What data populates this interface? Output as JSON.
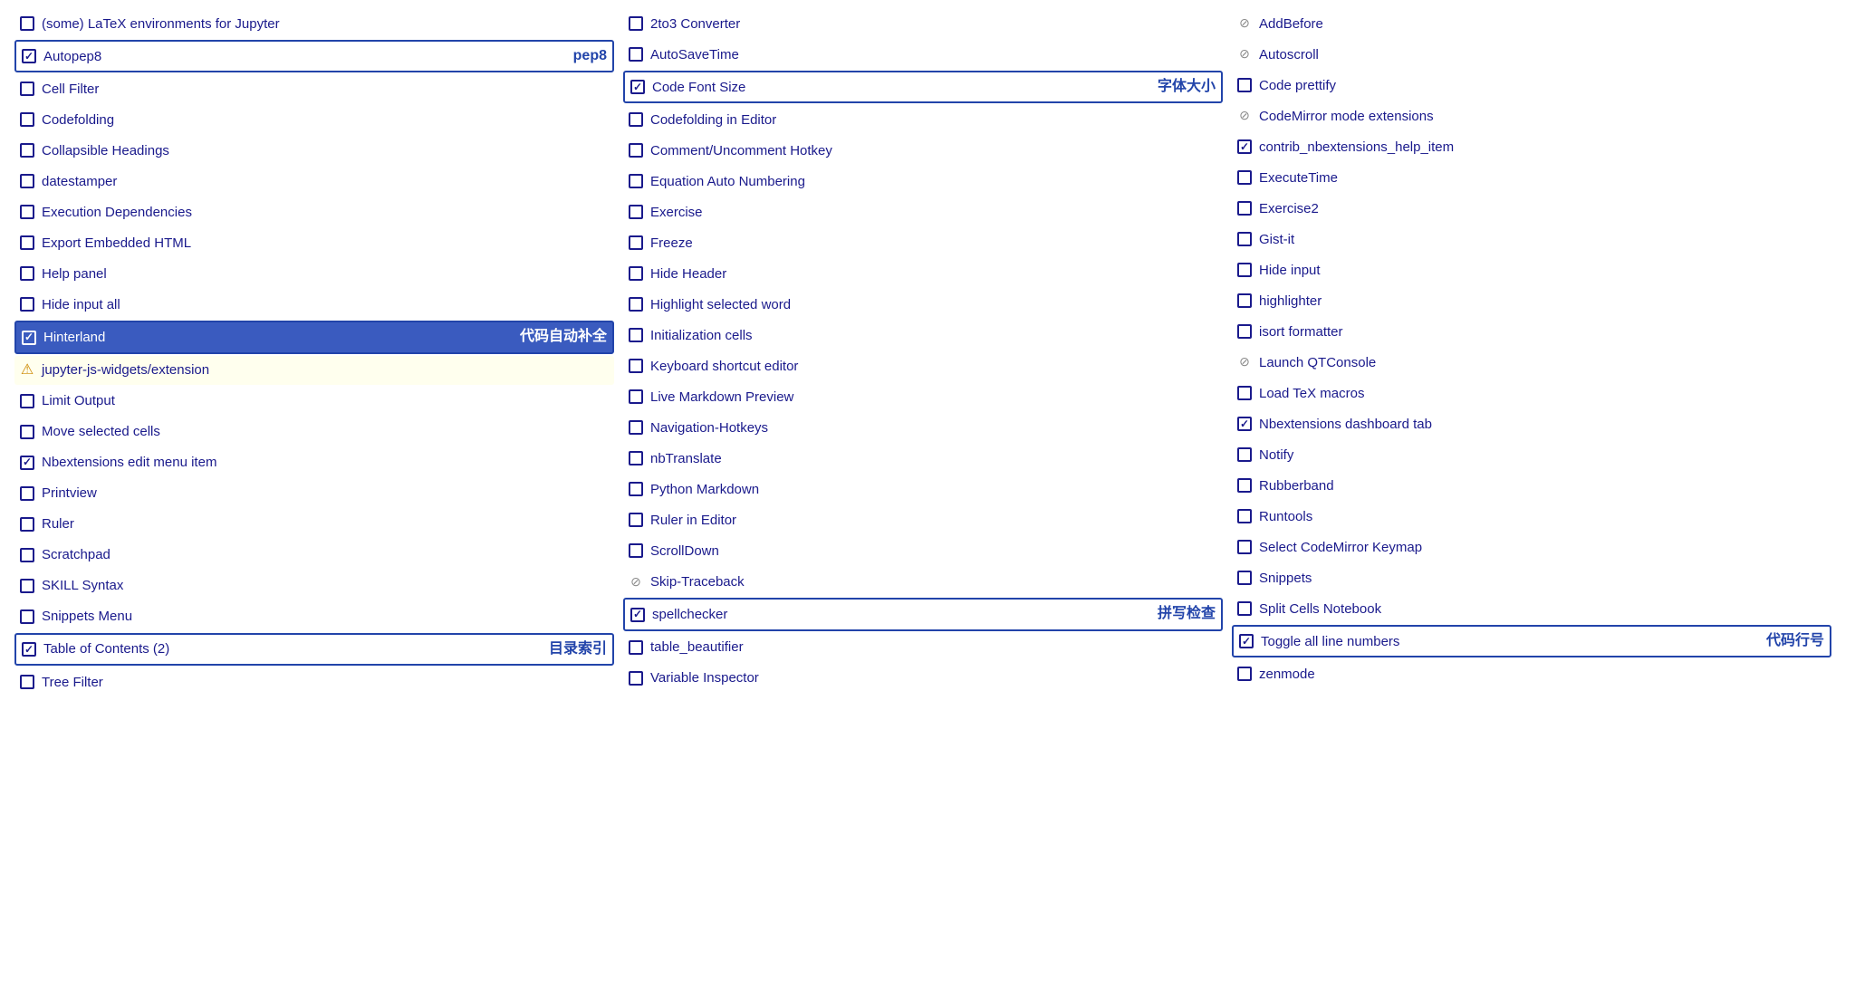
{
  "columns": [
    {
      "id": "col1",
      "items": [
        {
          "id": "latex",
          "check": "empty",
          "label": "(some) LaTeX environments for Jupyter",
          "badge": "",
          "style": "normal"
        },
        {
          "id": "autopep8",
          "check": "checked",
          "label": "Autopep8",
          "badge": "pep8",
          "style": "bordered"
        },
        {
          "id": "cell-filter",
          "check": "empty",
          "label": "Cell Filter",
          "badge": "",
          "style": "normal"
        },
        {
          "id": "codefolding",
          "check": "empty",
          "label": "Codefolding",
          "badge": "",
          "style": "normal"
        },
        {
          "id": "collapsible-headings",
          "check": "empty",
          "label": "Collapsible Headings",
          "badge": "",
          "style": "normal"
        },
        {
          "id": "datestamper",
          "check": "empty",
          "label": "datestamper",
          "badge": "",
          "style": "normal"
        },
        {
          "id": "execution-deps",
          "check": "empty",
          "label": "Execution Dependencies",
          "badge": "",
          "style": "normal"
        },
        {
          "id": "export-html",
          "check": "empty",
          "label": "Export Embedded HTML",
          "badge": "",
          "style": "normal"
        },
        {
          "id": "help-panel",
          "check": "empty",
          "label": "Help panel",
          "badge": "",
          "style": "normal"
        },
        {
          "id": "hide-input-all",
          "check": "empty",
          "label": "Hide input all",
          "badge": "",
          "style": "normal"
        },
        {
          "id": "hinterland",
          "check": "checked",
          "label": "Hinterland",
          "badge": "代码自动补全",
          "style": "highlighted"
        },
        {
          "id": "jupyter-js-widgets",
          "check": "warning",
          "label": "jupyter-js-widgets/extension",
          "badge": "",
          "style": "warning"
        },
        {
          "id": "limit-output",
          "check": "empty",
          "label": "Limit Output",
          "badge": "",
          "style": "normal"
        },
        {
          "id": "move-cells",
          "check": "empty",
          "label": "Move selected cells",
          "badge": "",
          "style": "normal"
        },
        {
          "id": "nbextensions-edit",
          "check": "checked",
          "label": "Nbextensions edit menu item",
          "badge": "",
          "style": "normal"
        },
        {
          "id": "printview",
          "check": "empty",
          "label": "Printview",
          "badge": "",
          "style": "normal"
        },
        {
          "id": "ruler",
          "check": "empty",
          "label": "Ruler",
          "badge": "",
          "style": "normal"
        },
        {
          "id": "scratchpad",
          "check": "empty",
          "label": "Scratchpad",
          "badge": "",
          "style": "normal"
        },
        {
          "id": "skill-syntax",
          "check": "empty",
          "label": "SKILL Syntax",
          "badge": "",
          "style": "normal"
        },
        {
          "id": "snippets-menu",
          "check": "empty",
          "label": "Snippets Menu",
          "badge": "",
          "style": "normal"
        },
        {
          "id": "toc2",
          "check": "checked",
          "label": "Table of Contents (2)",
          "badge": "目录索引",
          "style": "bordered"
        },
        {
          "id": "tree-filter",
          "check": "empty",
          "label": "Tree Filter",
          "badge": "",
          "style": "normal"
        }
      ]
    },
    {
      "id": "col2",
      "items": [
        {
          "id": "2to3",
          "check": "empty",
          "label": "2to3 Converter",
          "badge": "",
          "style": "normal"
        },
        {
          "id": "autosavetime",
          "check": "empty",
          "label": "AutoSaveTime",
          "badge": "",
          "style": "normal"
        },
        {
          "id": "code-font-size",
          "check": "checked",
          "label": "Code Font Size",
          "badge": "字体大小",
          "style": "bordered"
        },
        {
          "id": "codefolding-editor",
          "check": "empty",
          "label": "Codefolding in Editor",
          "badge": "",
          "style": "normal"
        },
        {
          "id": "comment-hotkey",
          "check": "empty",
          "label": "Comment/Uncomment Hotkey",
          "badge": "",
          "style": "normal"
        },
        {
          "id": "equation-auto",
          "check": "empty",
          "label": "Equation Auto Numbering",
          "badge": "",
          "style": "normal"
        },
        {
          "id": "exercise",
          "check": "empty",
          "label": "Exercise",
          "badge": "",
          "style": "normal"
        },
        {
          "id": "freeze",
          "check": "empty",
          "label": "Freeze",
          "badge": "",
          "style": "normal"
        },
        {
          "id": "hide-header",
          "check": "empty",
          "label": "Hide Header",
          "badge": "",
          "style": "normal"
        },
        {
          "id": "highlight-word",
          "check": "empty",
          "label": "Highlight selected word",
          "badge": "",
          "style": "normal"
        },
        {
          "id": "init-cells",
          "check": "empty",
          "label": "Initialization cells",
          "badge": "",
          "style": "normal"
        },
        {
          "id": "keyboard-shortcut",
          "check": "empty",
          "label": "Keyboard shortcut editor",
          "badge": "",
          "style": "normal"
        },
        {
          "id": "live-markdown",
          "check": "empty",
          "label": "Live Markdown Preview",
          "badge": "",
          "style": "normal"
        },
        {
          "id": "nav-hotkeys",
          "check": "empty",
          "label": "Navigation-Hotkeys",
          "badge": "",
          "style": "normal"
        },
        {
          "id": "nbtranslate",
          "check": "empty",
          "label": "nbTranslate",
          "badge": "",
          "style": "normal"
        },
        {
          "id": "python-markdown",
          "check": "empty",
          "label": "Python Markdown",
          "badge": "",
          "style": "normal"
        },
        {
          "id": "ruler-editor",
          "check": "empty",
          "label": "Ruler in Editor",
          "badge": "",
          "style": "normal"
        },
        {
          "id": "scrolldown",
          "check": "empty",
          "label": "ScrollDown",
          "badge": "",
          "style": "normal"
        },
        {
          "id": "skip-traceback",
          "check": "disabled",
          "label": "Skip-Traceback",
          "badge": "",
          "style": "normal"
        },
        {
          "id": "spellchecker",
          "check": "checked",
          "label": "spellchecker",
          "badge": "拼写检查",
          "style": "bordered"
        },
        {
          "id": "table-beautifier",
          "check": "empty",
          "label": "table_beautifier",
          "badge": "",
          "style": "normal"
        },
        {
          "id": "variable-inspector",
          "check": "empty",
          "label": "Variable Inspector",
          "badge": "",
          "style": "normal"
        }
      ]
    },
    {
      "id": "col3",
      "items": [
        {
          "id": "addbefore",
          "check": "disabled",
          "label": "AddBefore",
          "badge": "",
          "style": "normal"
        },
        {
          "id": "autoscroll",
          "check": "disabled",
          "label": "Autoscroll",
          "badge": "",
          "style": "normal"
        },
        {
          "id": "code-prettify",
          "check": "empty",
          "label": "Code prettify",
          "badge": "",
          "style": "normal"
        },
        {
          "id": "codemirror-mode",
          "check": "disabled",
          "label": "CodeMirror mode extensions",
          "badge": "",
          "style": "normal"
        },
        {
          "id": "contrib-help",
          "check": "checked",
          "label": "contrib_nbextensions_help_item",
          "badge": "",
          "style": "normal"
        },
        {
          "id": "execute-time",
          "check": "empty",
          "label": "ExecuteTime",
          "badge": "",
          "style": "normal"
        },
        {
          "id": "exercise2",
          "check": "empty",
          "label": "Exercise2",
          "badge": "",
          "style": "normal"
        },
        {
          "id": "gist-it",
          "check": "empty",
          "label": "Gist-it",
          "badge": "",
          "style": "normal"
        },
        {
          "id": "hide-input",
          "check": "empty",
          "label": "Hide input",
          "badge": "",
          "style": "normal"
        },
        {
          "id": "highlighter",
          "check": "empty",
          "label": "highlighter",
          "badge": "",
          "style": "normal"
        },
        {
          "id": "isort-formatter",
          "check": "empty",
          "label": "isort formatter",
          "badge": "",
          "style": "normal"
        },
        {
          "id": "launch-qtconsole",
          "check": "disabled",
          "label": "Launch QTConsole",
          "badge": "",
          "style": "normal"
        },
        {
          "id": "load-tex-macros",
          "check": "empty",
          "label": "Load TeX macros",
          "badge": "",
          "style": "normal"
        },
        {
          "id": "nbextensions-dashboard",
          "check": "checked",
          "label": "Nbextensions dashboard tab",
          "badge": "",
          "style": "normal"
        },
        {
          "id": "notify",
          "check": "empty",
          "label": "Notify",
          "badge": "",
          "style": "normal"
        },
        {
          "id": "rubberband",
          "check": "empty",
          "label": "Rubberband",
          "badge": "",
          "style": "normal"
        },
        {
          "id": "runtools",
          "check": "empty",
          "label": "Runtools",
          "badge": "",
          "style": "normal"
        },
        {
          "id": "select-codemirror",
          "check": "empty",
          "label": "Select CodeMirror Keymap",
          "badge": "",
          "style": "normal"
        },
        {
          "id": "snippets",
          "check": "empty",
          "label": "Snippets",
          "badge": "",
          "style": "normal"
        },
        {
          "id": "split-cells",
          "check": "empty",
          "label": "Split Cells Notebook",
          "badge": "",
          "style": "normal"
        },
        {
          "id": "toggle-line-numbers",
          "check": "checked",
          "label": "Toggle all line numbers",
          "badge": "代码行号",
          "style": "bordered"
        },
        {
          "id": "zenmode",
          "check": "empty",
          "label": "zenmode",
          "badge": "",
          "style": "normal"
        }
      ]
    }
  ]
}
